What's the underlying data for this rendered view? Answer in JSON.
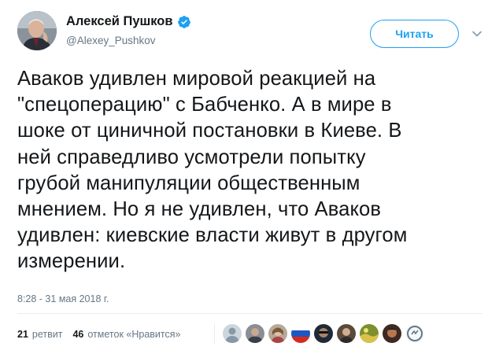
{
  "tweet": {
    "author_name": "Алексей Пушков",
    "author_handle": "@Alexey_Pushkov",
    "follow_label": "Читать",
    "text_lines": [
      "Аваков удивлен мировой реакцией на",
      "\"спецоперацию\" с Бабченко. А в мире в",
      "шоке от циничной постановки в Киеве. В",
      "ней справедливо усмотрели попытку",
      "грубой манипуляции общественным",
      "мнением. Но я не удивлен, что Аваков",
      "удивлен: киевские власти живут в другом",
      "измерении."
    ],
    "timestamp": "8:28 - 31 мая 2018 г."
  },
  "stats": {
    "retweets_count": "21",
    "retweets_label": "ретвит",
    "likes_count": "46",
    "likes_label": "отметок «Нравится»"
  },
  "icons": {
    "verified": "verified-badge-icon",
    "menu": "chevron-down-icon"
  },
  "colors": {
    "accent": "#1da1f2",
    "text": "#14171a",
    "secondary": "#657786",
    "divider": "#e6ecf0"
  }
}
